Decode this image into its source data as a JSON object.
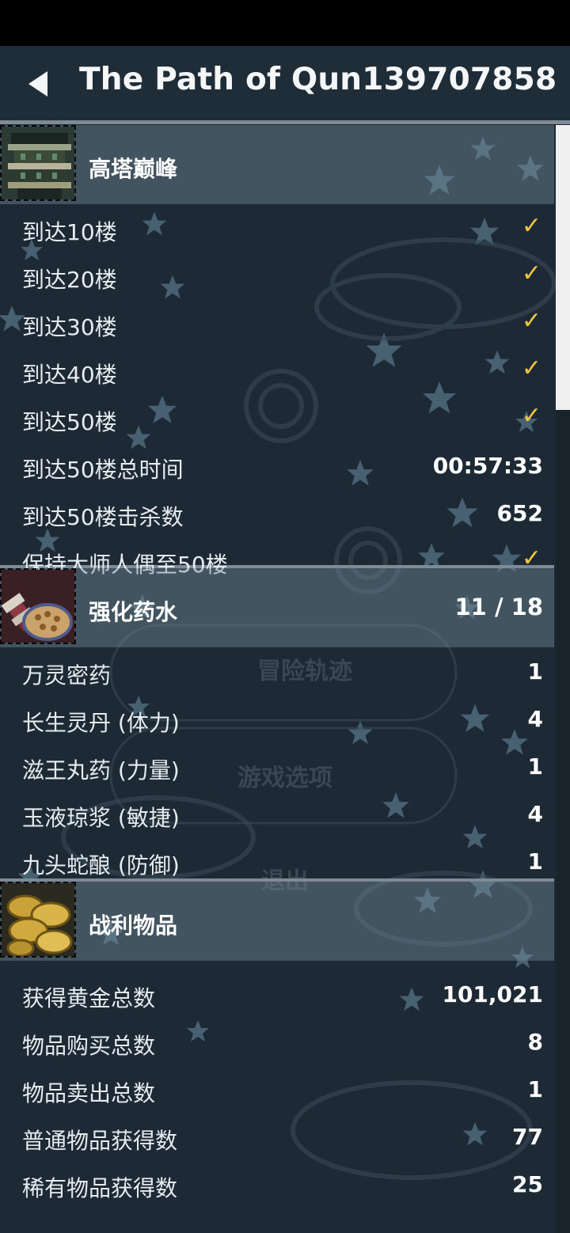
{
  "header": {
    "title": "The Path of Qun139707858"
  },
  "background_menu": [
    "冒险轨迹",
    "游戏选项",
    "退出"
  ],
  "sections": [
    {
      "title": "高塔巅峰",
      "progress": "",
      "rows": [
        {
          "label": "到达10楼",
          "value": "",
          "check": "✓"
        },
        {
          "label": "到达20楼",
          "value": "",
          "check": "✓"
        },
        {
          "label": "到达30楼",
          "value": "",
          "check": "✓"
        },
        {
          "label": "到达40楼",
          "value": "",
          "check": "✓"
        },
        {
          "label": "到达50楼",
          "value": "",
          "check": "✓"
        },
        {
          "label": "到达50楼总时间",
          "value": "00:57:33",
          "check": ""
        },
        {
          "label": "到达50楼击杀数",
          "value": "652",
          "check": ""
        },
        {
          "label": "保持大师人偶至50楼",
          "value": "",
          "check": "✓"
        }
      ]
    },
    {
      "title": "强化药水",
      "progress": "11 / 18",
      "rows": [
        {
          "label": "万灵密药",
          "value": "1",
          "check": ""
        },
        {
          "label": "长生灵丹 (体力)",
          "value": "4",
          "check": ""
        },
        {
          "label": "滋王丸药 (力量)",
          "value": "1",
          "check": ""
        },
        {
          "label": "玉液琼浆 (敏捷)",
          "value": "4",
          "check": ""
        },
        {
          "label": "九头蛇酿 (防御)",
          "value": "1",
          "check": ""
        }
      ]
    },
    {
      "title": "战利物品",
      "progress": "",
      "rows": [
        {
          "label": "获得黄金总数",
          "value": "101,021",
          "check": ""
        },
        {
          "label": "物品购买总数",
          "value": "8",
          "check": ""
        },
        {
          "label": "物品卖出总数",
          "value": "1",
          "check": ""
        },
        {
          "label": "普通物品获得数",
          "value": "77",
          "check": ""
        },
        {
          "label": "稀有物品获得数",
          "value": "25",
          "check": ""
        }
      ]
    }
  ],
  "colors": {
    "accent_check": "#f2c73c",
    "bg": "#1d2a35",
    "section_band": "#5d7282"
  }
}
